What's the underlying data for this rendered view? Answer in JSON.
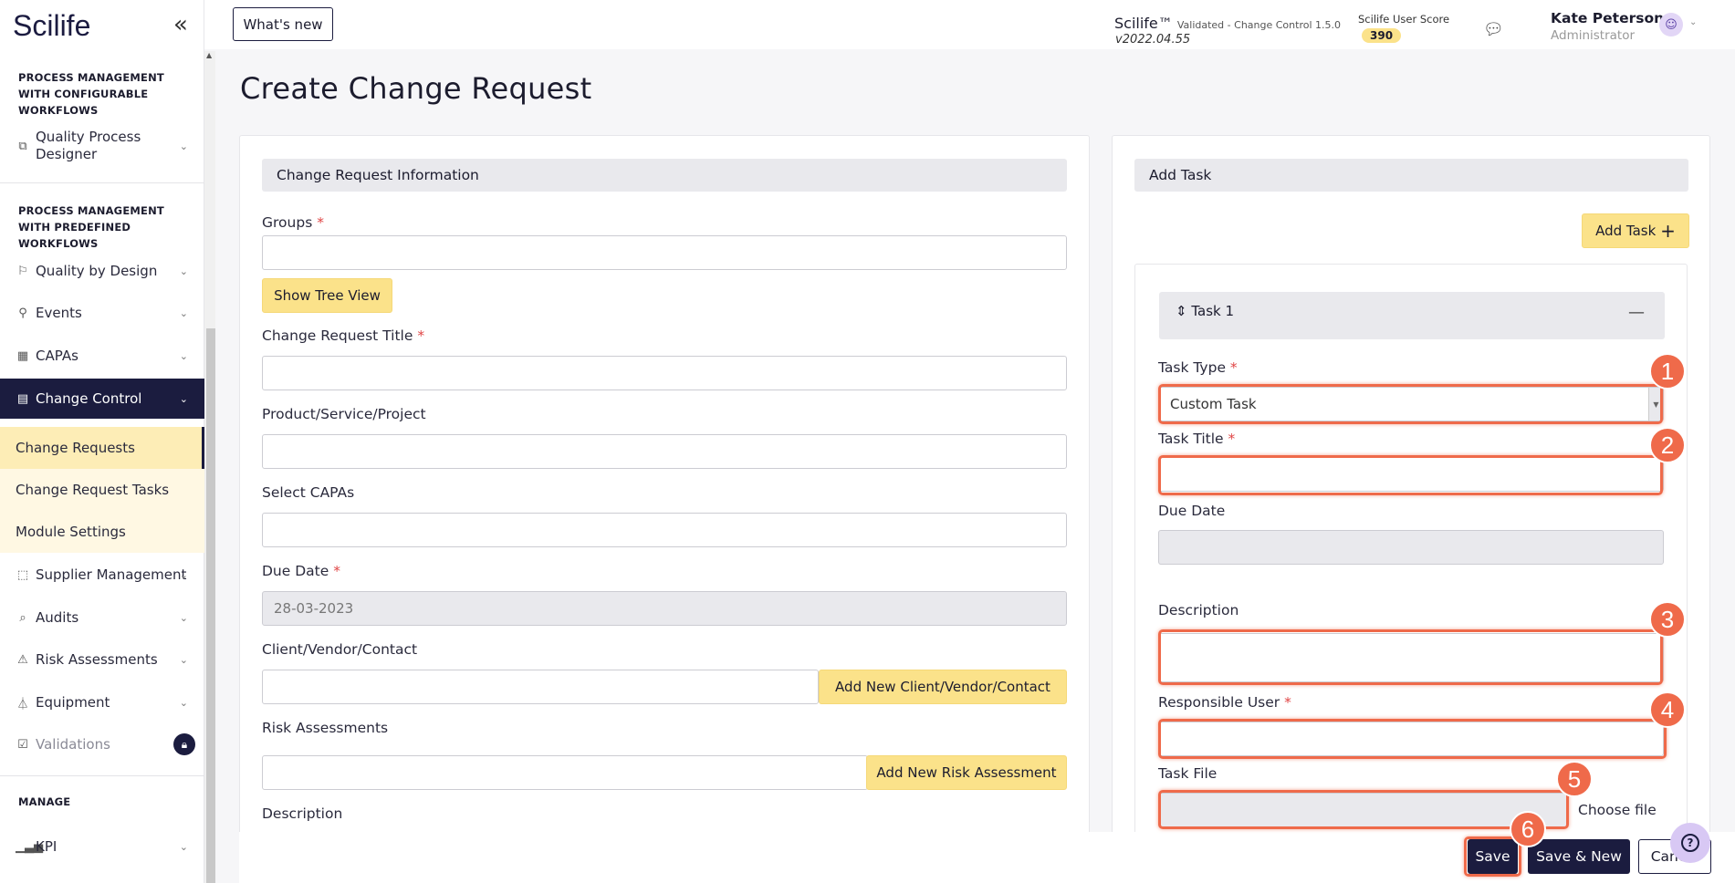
{
  "sidebar": {
    "logo": "Scilife",
    "section_configurable": "PROCESS MANAGEMENT WITH CONFIGURABLE WORKFLOWS",
    "section_predefined": "PROCESS MANAGEMENT WITH PREDEFINED WORKFLOWS",
    "section_manage": "MANAGE",
    "items": [
      {
        "label": "Quality Process Designer"
      },
      {
        "label": "Quality by Design"
      },
      {
        "label": "Events"
      },
      {
        "label": "CAPAs"
      },
      {
        "label": "Change Control"
      },
      {
        "label": "Supplier Management"
      },
      {
        "label": "Audits"
      },
      {
        "label": "Risk Assessments"
      },
      {
        "label": "Equipment"
      },
      {
        "label": "Validations"
      },
      {
        "label": "KPI"
      }
    ],
    "sub_items": [
      {
        "label": "Change Requests"
      },
      {
        "label": "Change Request Tasks"
      },
      {
        "label": "Module Settings"
      }
    ]
  },
  "topbar": {
    "whats_new": "What's new",
    "brand": "Scilife™",
    "brand_detail": "Validated - Change Control 1.5.0",
    "version": "v2022.04.55",
    "score_label": "Scilife User Score",
    "score": "390",
    "user_name": "Kate Peterson",
    "user_role": "Administrator"
  },
  "page": {
    "title": "Create Change Request"
  },
  "left_card": {
    "header": "Change Request Information",
    "groups_label": "Groups",
    "show_tree": "Show Tree View",
    "title_label": "Change Request Title",
    "product_label": "Product/Service/Project",
    "capas_label": "Select CAPAs",
    "due_label": "Due Date",
    "due_value": "28-03-2023",
    "client_label": "Client/Vendor/Contact",
    "add_client": "Add New Client/Vendor/Contact",
    "risk_label": "Risk Assessments",
    "add_risk": "Add New Risk Assessment",
    "desc_label": "Description"
  },
  "right_card": {
    "header": "Add Task",
    "add_task": "Add Task",
    "task_header": "Task 1",
    "task_type_label": "Task Type",
    "task_type_value": "Custom Task",
    "task_title_label": "Task Title",
    "due_label": "Due Date",
    "desc_label": "Description",
    "responsible_label": "Responsible User",
    "file_label": "Task File",
    "choose_file": "Choose file"
  },
  "footer": {
    "save": "Save",
    "save_new": "Save & New",
    "cancel": "Cancel"
  },
  "badges": [
    "1",
    "2",
    "3",
    "4",
    "5",
    "6"
  ],
  "colors": {
    "navy": "#1b1c3f",
    "yellow": "#fbe28a",
    "highlight": "#ef6a4a"
  }
}
